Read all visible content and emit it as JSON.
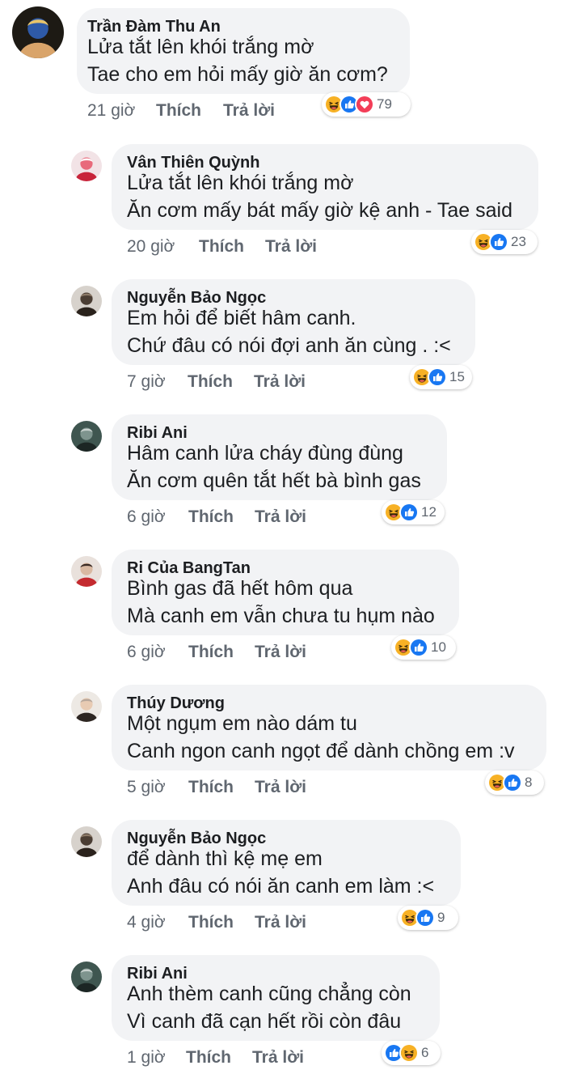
{
  "actions": {
    "like": "Thích",
    "reply": "Trả lời"
  },
  "comments": [
    {
      "author": "Trần Đàm Thu An",
      "lines": [
        "Lửa tắt lên khói trắng mờ",
        "Tae cho em hỏi mấy giờ ăn cơm?"
      ],
      "time": "21 giờ",
      "reactions": [
        "haha-icon",
        "like-icon",
        "love-icon"
      ],
      "count": "79",
      "avatar": "avatar-pearl-earring"
    },
    {
      "author": "Vân Thiên Quỳnh",
      "lines": [
        "Lửa tắt lên khói trắng mờ",
        "Ăn cơm mấy bát mấy giờ kệ anh - Tae said"
      ],
      "time": "20 giờ",
      "reactions": [
        "haha-icon",
        "like-icon"
      ],
      "count": "23",
      "avatar": "avatar-red-floral"
    },
    {
      "author": "Nguyễn Bảo Ngọc",
      "lines": [
        "Em hỏi để biết hâm canh.",
        "Chứ đâu có nói đợi anh ăn cùng . :<"
      ],
      "time": "7 giờ",
      "reactions": [
        "haha-icon",
        "like-icon"
      ],
      "count": "15",
      "avatar": "avatar-person-dark"
    },
    {
      "author": "Ribi Ani",
      "lines": [
        "Hâm canh lửa cháy đùng đùng",
        "Ăn cơm quên tắt hết bà bình gas"
      ],
      "time": "6 giờ",
      "reactions": [
        "haha-icon",
        "like-icon"
      ],
      "count": "12",
      "avatar": "avatar-person-teal"
    },
    {
      "author": "Ri Của BangTan",
      "lines": [
        "Bình gas đã hết hôm qua",
        "Mà canh em vẫn chưa tu hụm nào"
      ],
      "time": "6 giờ",
      "reactions": [
        "haha-icon",
        "like-icon"
      ],
      "count": "10",
      "avatar": "avatar-red-cap"
    },
    {
      "author": "Thúy Dương",
      "lines": [
        "Một ngụm em nào dám tu",
        "Canh ngon canh ngọt để dành chồng em :v"
      ],
      "time": "5 giờ",
      "reactions": [
        "haha-icon",
        "like-icon"
      ],
      "count": "8",
      "avatar": "avatar-person-light"
    },
    {
      "author": "Nguyễn Bảo Ngọc",
      "lines": [
        "để dành thì kệ mẹ em",
        "Anh đâu có nói ăn canh em làm :<"
      ],
      "time": "4 giờ",
      "reactions": [
        "haha-icon",
        "like-icon"
      ],
      "count": "9",
      "avatar": "avatar-person-dark"
    },
    {
      "author": "Ribi Ani",
      "lines": [
        "Anh thèm canh cũng chẳng còn",
        "Vì canh đã cạn hết rồi còn đâu"
      ],
      "time": "1 giờ",
      "reactions": [
        "like-icon",
        "haha-icon"
      ],
      "count": "6",
      "avatar": "avatar-person-teal"
    }
  ],
  "colors": {
    "bubble": "#f2f3f5",
    "text": "#1c1e21",
    "meta": "#606770",
    "like": "#1877f2",
    "love": "#f33e58",
    "haha": "#f7b125"
  }
}
